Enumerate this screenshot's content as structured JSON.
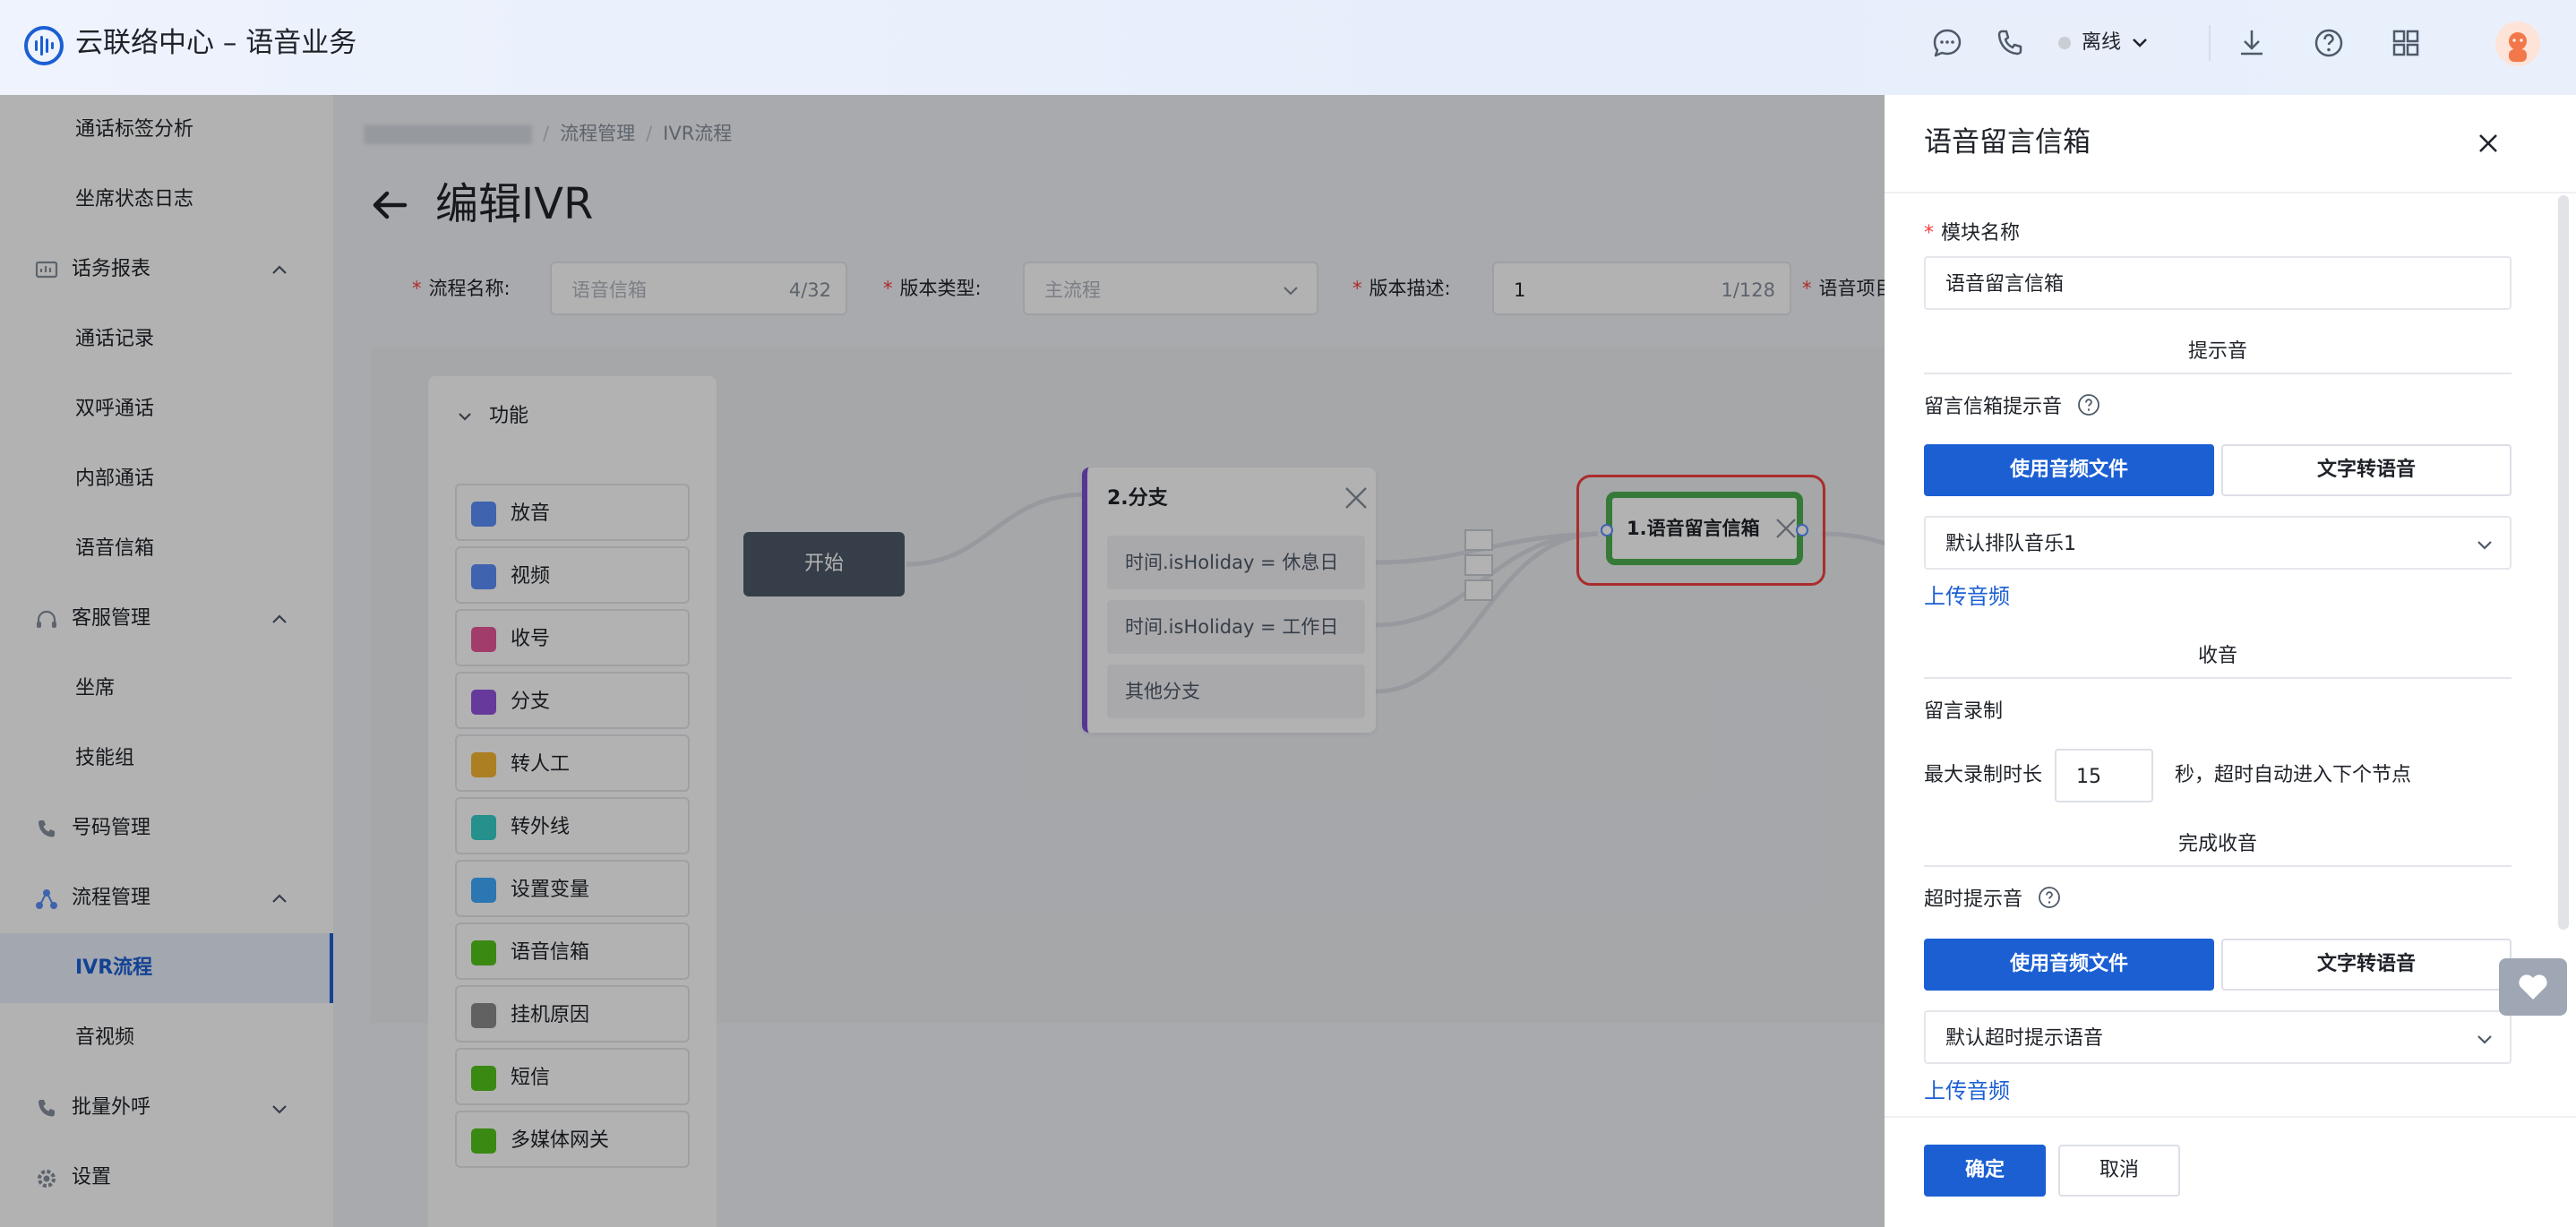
{
  "header": {
    "app_title": "云联络中心 – 语音业务",
    "status": "离线"
  },
  "sidebar": {
    "items": [
      {
        "label": "通话标签分析",
        "type": "child"
      },
      {
        "label": "坐席状态日志",
        "type": "child"
      },
      {
        "label": "话务报表",
        "type": "group",
        "icon": "report-icon",
        "expanded": true
      },
      {
        "label": "通话记录",
        "type": "child"
      },
      {
        "label": "双呼通话",
        "type": "child"
      },
      {
        "label": "内部通话",
        "type": "child"
      },
      {
        "label": "语音信箱",
        "type": "child"
      },
      {
        "label": "客服管理",
        "type": "group",
        "icon": "headset-icon",
        "expanded": true
      },
      {
        "label": "坐席",
        "type": "child"
      },
      {
        "label": "技能组",
        "type": "child"
      },
      {
        "label": "号码管理",
        "type": "group",
        "icon": "phone-icon"
      },
      {
        "label": "流程管理",
        "type": "group",
        "icon": "flow-icon",
        "expanded": true
      },
      {
        "label": "IVR流程",
        "type": "child",
        "active": true
      },
      {
        "label": "音视频",
        "type": "child"
      },
      {
        "label": "批量外呼",
        "type": "group",
        "icon": "outbound-icon",
        "expanded": false
      },
      {
        "label": "设置",
        "type": "group",
        "icon": "gear-icon"
      }
    ]
  },
  "breadcrumb": {
    "items": [
      "流程管理",
      "IVR流程"
    ]
  },
  "page": {
    "title": "编辑IVR"
  },
  "form": {
    "flow_name": {
      "label": "流程名称:",
      "value": "语音信箱",
      "count": "4/32"
    },
    "version_type": {
      "label": "版本类型:",
      "value": "主流程"
    },
    "version_desc": {
      "label": "版本描述:",
      "value": "1",
      "count": "1/128"
    },
    "voice_item": {
      "label": "语音项目"
    }
  },
  "palette": {
    "title": "功能",
    "items": [
      {
        "label": "放音",
        "icon": "playback-icon",
        "color": "#5b8ff9"
      },
      {
        "label": "视频",
        "icon": "video-icon",
        "color": "#5b8ff9"
      },
      {
        "label": "收号",
        "icon": "keypad-icon",
        "color": "#e8589a"
      },
      {
        "label": "分支",
        "icon": "branch-icon",
        "color": "#9254de"
      },
      {
        "label": "转人工",
        "icon": "agent-icon",
        "color": "#f7b731"
      },
      {
        "label": "转外线",
        "icon": "external-line-icon",
        "color": "#36cfc9"
      },
      {
        "label": "设置变量",
        "icon": "variable-icon",
        "color": "#40a9ff"
      },
      {
        "label": "语音信箱",
        "icon": "voicemail-icon",
        "color": "#52c41a"
      },
      {
        "label": "挂机原因",
        "icon": "hangup-icon",
        "color": "#8c8c8c"
      },
      {
        "label": "短信",
        "icon": "sms-icon",
        "color": "#52c41a"
      },
      {
        "label": "多媒体网关",
        "icon": "gateway-icon",
        "color": "#52c41a"
      }
    ]
  },
  "flow": {
    "start_label": "开始",
    "branch": {
      "title": "2.分支",
      "options": [
        "时间.isHoliday = 休息日",
        "时间.isHoliday = 工作日",
        "其他分支"
      ]
    },
    "mailbox_node_label": "1.语音留言信箱"
  },
  "drawer": {
    "title": "语音留言信箱",
    "module_name_label": "模块名称",
    "module_name_value": "语音留言信箱",
    "section_prompt": "提示音",
    "mailbox_prompt_label": "留言信箱提示音",
    "btn_audio_file": "使用音频文件",
    "btn_tts": "文字转语音",
    "prompt_select_value": "默认排队音乐1",
    "upload_audio": "上传音频",
    "section_record": "收音",
    "record_label": "留言录制",
    "max_duration_label": "最大录制时长",
    "max_duration_value": "15",
    "max_duration_hint": "秒，超时自动进入下个节点",
    "section_finish": "完成收音",
    "timeout_prompt_label": "超时提示音",
    "timeout_select_value": "默认超时提示语音",
    "confirm": "确定",
    "cancel": "取消"
  },
  "colors": {
    "primary": "#1b5fd3",
    "danger": "#f53f3f",
    "node_selected": "#4caf50",
    "branch_accent": "#7b4ed6"
  }
}
